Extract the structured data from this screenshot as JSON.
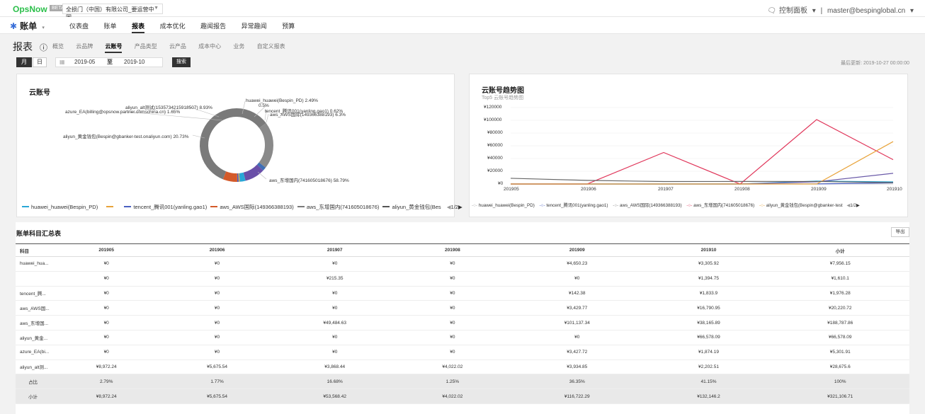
{
  "topbar": {
    "logo": "OpsNow",
    "logo_badge": "BETA",
    "org": "全损门（中国）有限公司_要运营中国",
    "control_panel": "控制面板",
    "user": "master@bespinglobal.cn"
  },
  "nav": {
    "app": "账单",
    "items": [
      "仪表盘",
      "账单",
      "报表",
      "成本优化",
      "趣闻报告",
      "异常趣闻",
      "预算"
    ],
    "active_index": 2
  },
  "report": {
    "title": "报表",
    "tabs": [
      "概览",
      "云品牌",
      "云账号",
      "产品类型",
      "云产品",
      "成本中心",
      "业务",
      "自定义报表"
    ],
    "active_tab": 2
  },
  "filters": {
    "month": "月",
    "day": "日",
    "from": "2019-05",
    "to_label": "至",
    "to": "2019-10",
    "search": "搜索",
    "last_update": "最后更新: 2019-10-27 00:00:00"
  },
  "donut": {
    "title": "云账号",
    "slices": [
      {
        "label": "aws_东增国内(741605018676) 58.79%",
        "value": 58.79,
        "color": "#7a7a7a"
      },
      {
        "label": "aliyun_黄金钱包(Bespin@gbanker-test.onaliyun.com) 20.73%",
        "value": 20.73,
        "color": "#8a8a8a"
      },
      {
        "label": "azure_EA(billing@opsnow.partner.onmschina.cn) 1.65%",
        "value": 1.65,
        "color": "#3f6fb5"
      },
      {
        "label": "aliyun_alt测试(1535734215918507) 8.93%",
        "value": 8.93,
        "color": "#6a4fa8"
      },
      {
        "label": "huawei_huawei(Bespin_PD) 2.49%",
        "value": 2.49,
        "color": "#2aa7d6"
      },
      {
        "label": "0.5%",
        "value": 0.5,
        "color": "#e8a33a"
      },
      {
        "label": "tencent_腾讯001(yanling.gao1) 0.62%",
        "value": 0.62,
        "color": "#4a5fc1"
      },
      {
        "label": "aws_AWS国际(149366388193) 6.3%",
        "value": 6.3,
        "color": "#d45a2a"
      }
    ],
    "legend": [
      {
        "label": "huawei_huawei(Bespin_PD)",
        "color": "#2aa7d6"
      },
      {
        "label": "",
        "color": "#e8a33a"
      },
      {
        "label": "tencent_腾讯001(yanling.gao1)",
        "color": "#4a5fc1"
      },
      {
        "label": "aws_AWS国际(149366388193)",
        "color": "#d45a2a"
      },
      {
        "label": "aws_东增国内(741605018676)",
        "color": "#7a7a7a"
      },
      {
        "label": "aliyun_黄金钱包(Bes",
        "color": "#555555"
      }
    ],
    "pager": "1/2"
  },
  "chart_data": {
    "type": "line",
    "title": "云账号趋势图",
    "subtitle": "Top5 云账号趋势图",
    "x": [
      "201905",
      "201906",
      "201907",
      "201908",
      "201909",
      "201910"
    ],
    "yticks": [
      "¥120000",
      "¥100000",
      "¥80000",
      "¥60000",
      "¥40000",
      "¥20000",
      "¥0"
    ],
    "ylim": [
      0,
      120000
    ],
    "series": [
      {
        "name": "huawei_huawei(Bespin_PD)",
        "color": "#2aa7d6",
        "values": [
          0,
          0,
          0,
          0,
          4650,
          3306
        ]
      },
      {
        "name": "tencent_腾讯001(yanling.gao1)",
        "color": "#4a5fc1",
        "values": [
          0,
          0,
          0,
          0,
          142,
          1834
        ]
      },
      {
        "name": "aws_AWS国际(149366388193)",
        "color": "#6a5aa8",
        "values": [
          0,
          0,
          0,
          0,
          3430,
          16791
        ]
      },
      {
        "name": "aws_东增国内(741605018676)",
        "color": "#e0365a",
        "values": [
          0,
          0,
          49485,
          0,
          101137,
          38166
        ]
      },
      {
        "name": "aliyun_黄金钱包(Bespin@gbanker-test",
        "color": "#e8a33a",
        "values": [
          0,
          0,
          0,
          0,
          0,
          66578
        ]
      },
      {
        "name": "aliyun_alt测试",
        "color": "#666666",
        "values": [
          8972,
          5676,
          3868,
          4022,
          3935,
          2203
        ]
      }
    ],
    "legend_labels": [
      "huawei_huawei(Bespin_PD)",
      "tencent_腾讯001(yanling.gao1)",
      "aws_AWS国际(149366388193)",
      "aws_东增国内(741605018676)",
      "aliyun_黄金钱包(Bespin@gbanker-test"
    ],
    "pager": "1/2"
  },
  "table": {
    "title": "账单科目汇总表",
    "export": "导出",
    "headers": [
      "科目",
      "201905",
      "201906",
      "201907",
      "201908",
      "201909",
      "201910",
      "小计"
    ],
    "rows": [
      [
        "huawei_hua...",
        "¥0",
        "¥0",
        "¥0",
        "¥0",
        "¥4,650.23",
        "¥3,305.92",
        "¥7,956.15"
      ],
      [
        "",
        "¥0",
        "¥0",
        "¥215.35",
        "¥0",
        "¥0",
        "¥1,394.75",
        "¥1,610.1"
      ],
      [
        "tencent_腾...",
        "¥0",
        "¥0",
        "¥0",
        "¥0",
        "¥142.38",
        "¥1,833.9",
        "¥1,976.28"
      ],
      [
        "aws_AWS国...",
        "¥0",
        "¥0",
        "¥0",
        "¥0",
        "¥3,429.77",
        "¥16,790.95",
        "¥20,220.72"
      ],
      [
        "aws_东增国...",
        "¥0",
        "¥0",
        "¥49,484.63",
        "¥0",
        "¥101,137.34",
        "¥38,165.89",
        "¥188,787.86"
      ],
      [
        "aliyun_黄金...",
        "¥0",
        "¥0",
        "¥0",
        "¥0",
        "¥0",
        "¥66,578.09",
        "¥66,578.09"
      ],
      [
        "azure_EA(bi...",
        "¥0",
        "¥0",
        "¥0",
        "¥0",
        "¥3,427.72",
        "¥1,874.19",
        "¥5,301.91"
      ],
      [
        "aliyun_alt测...",
        "¥8,972.24",
        "¥5,675.54",
        "¥3,868.44",
        "¥4,022.02",
        "¥3,934.85",
        "¥2,202.51",
        "¥28,675.6"
      ]
    ],
    "grey_rows": [
      [
        "占比",
        "2.79%",
        "1.77%",
        "16.68%",
        "1.25%",
        "36.35%",
        "41.15%",
        "100%"
      ],
      [
        "小计",
        "¥8,972.24",
        "¥5,675.54",
        "¥53,568.42",
        "¥4,022.02",
        "¥116,722.29",
        "¥132,146.2",
        "¥321,106.71"
      ]
    ]
  }
}
